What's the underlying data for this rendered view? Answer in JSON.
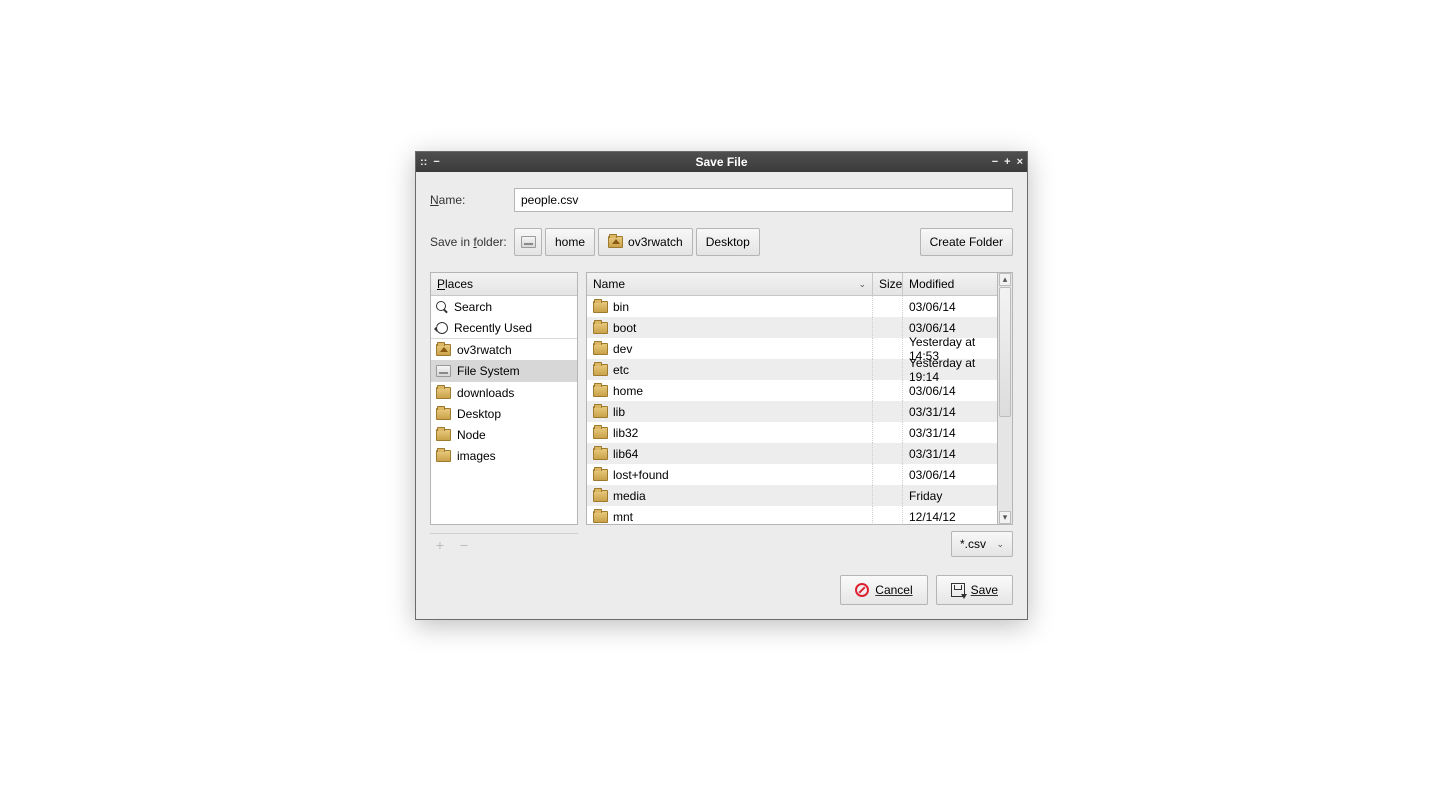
{
  "window": {
    "title": "Save File"
  },
  "name_row": {
    "label": "Name:",
    "value": "people.csv"
  },
  "folder_row": {
    "label": "Save in folder:",
    "path": [
      "home",
      "ov3rwatch",
      "Desktop"
    ],
    "create_folder": "Create Folder"
  },
  "places": {
    "header": "Places",
    "quick": [
      {
        "icon": "search",
        "label": "Search"
      },
      {
        "icon": "recent",
        "label": "Recently Used"
      }
    ],
    "locations": [
      {
        "icon": "home-folder",
        "label": "ov3rwatch",
        "selected": false
      },
      {
        "icon": "drive",
        "label": "File System",
        "selected": true
      }
    ],
    "bookmarks": [
      {
        "label": "downloads"
      },
      {
        "label": "Desktop"
      },
      {
        "label": "Node"
      },
      {
        "label": "images"
      }
    ]
  },
  "table": {
    "headers": {
      "name": "Name",
      "size": "Size",
      "modified": "Modified"
    },
    "rows": [
      {
        "name": "bin",
        "size": "",
        "modified": "03/06/14"
      },
      {
        "name": "boot",
        "size": "",
        "modified": "03/06/14"
      },
      {
        "name": "dev",
        "size": "",
        "modified": "Yesterday at 14:53"
      },
      {
        "name": "etc",
        "size": "",
        "modified": "Yesterday at 19:14"
      },
      {
        "name": "home",
        "size": "",
        "modified": "03/06/14"
      },
      {
        "name": "lib",
        "size": "",
        "modified": "03/31/14"
      },
      {
        "name": "lib32",
        "size": "",
        "modified": "03/31/14"
      },
      {
        "name": "lib64",
        "size": "",
        "modified": "03/31/14"
      },
      {
        "name": "lost+found",
        "size": "",
        "modified": "03/06/14"
      },
      {
        "name": "media",
        "size": "",
        "modified": "Friday"
      },
      {
        "name": "mnt",
        "size": "",
        "modified": "12/14/12"
      }
    ]
  },
  "filter": {
    "selected": "*.csv"
  },
  "actions": {
    "cancel": "Cancel",
    "save": "Save"
  }
}
